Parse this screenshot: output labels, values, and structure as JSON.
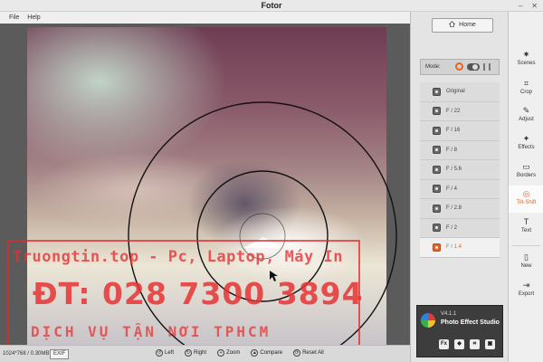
{
  "window": {
    "title": "Fotor"
  },
  "menu": [
    {
      "label": "File"
    },
    {
      "label": "Help"
    }
  ],
  "rightpanel": {
    "home_label": "Home",
    "mode_label": "Mode:",
    "presets": [
      {
        "label": "Original"
      },
      {
        "label": "F / 22"
      },
      {
        "label": "F / 16"
      },
      {
        "label": "F / 8"
      },
      {
        "label": "F / 5.6"
      },
      {
        "label": "F / 4"
      },
      {
        "label": "F / 2.8"
      },
      {
        "label": "F / 2"
      },
      {
        "label": "F / 1.4",
        "active": true
      }
    ],
    "promo": {
      "version": "V4.1.1",
      "title": "Photo Effect Studio",
      "icon_fx": "Fx"
    }
  },
  "sidebar": [
    {
      "label": "Scenes",
      "icon": "scenes-icon"
    },
    {
      "label": "Crop",
      "icon": "crop-icon"
    },
    {
      "label": "Adjust",
      "icon": "adjust-icon"
    },
    {
      "label": "Effects",
      "icon": "effects-icon"
    },
    {
      "label": "Borders",
      "icon": "borders-icon"
    },
    {
      "label": "Tilt-Shift",
      "icon": "tilt-shift-icon",
      "active": true
    },
    {
      "label": "Text",
      "icon": "text-icon"
    },
    {
      "label": "New",
      "icon": "new-icon"
    },
    {
      "label": "Export",
      "icon": "export-icon"
    }
  ],
  "statusbar": {
    "image_info": "1024*768 / 0.30MB",
    "exif_label": "EXIF",
    "tools": [
      {
        "label": "Left",
        "icon": "rotate-left-icon"
      },
      {
        "label": "Right",
        "icon": "rotate-right-icon"
      },
      {
        "label": "Zoom",
        "icon": "zoom-icon"
      },
      {
        "label": "Compare",
        "icon": "compare-icon"
      },
      {
        "label": "Reset All",
        "icon": "reset-icon"
      }
    ]
  },
  "watermark": {
    "line1": "Truongtin.top - Pc, Laptop, Máy In",
    "line2": "ĐT: 028 7300 3894",
    "line3": "DỊCH VỤ TẬN NƠI TPHCM"
  },
  "colors": {
    "accent": "#e0662a",
    "ring": "#111111"
  }
}
